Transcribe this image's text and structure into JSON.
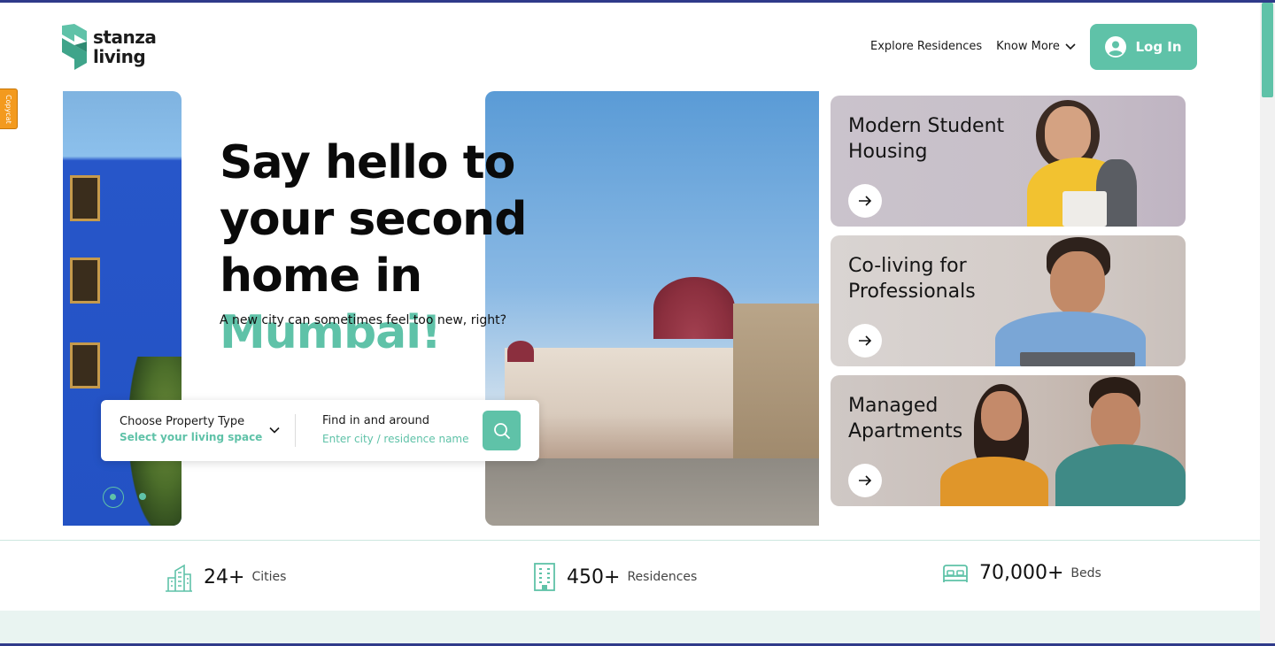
{
  "brand": {
    "line1": "stanza",
    "line2": "living",
    "accent": "#5fc2a8"
  },
  "nav": {
    "explore": "Explore Residences",
    "know_more": "Know More",
    "login": "Log In"
  },
  "extension_tab": "Copycat",
  "hero": {
    "title_line1": "Say hello to your",
    "title_line2": "second home in",
    "city": "Mumbai!",
    "subtitle": "A new city can sometimes feel too new, right?"
  },
  "search": {
    "property_label": "Choose Property Type",
    "property_value": "Select your living space",
    "find_label": "Find in and around",
    "find_placeholder": "Enter city / residence name"
  },
  "cards": [
    {
      "title": "Modern Student Housing"
    },
    {
      "title": "Co-living for Professionals"
    },
    {
      "title": "Managed Apartments"
    }
  ],
  "stats": [
    {
      "value": "24+",
      "label": "Cities",
      "icon": "city-buildings-icon"
    },
    {
      "value": "450+",
      "label": "Residences",
      "icon": "building-icon"
    },
    {
      "value": "70,000+",
      "label": "Beds",
      "icon": "bed-icon"
    }
  ]
}
